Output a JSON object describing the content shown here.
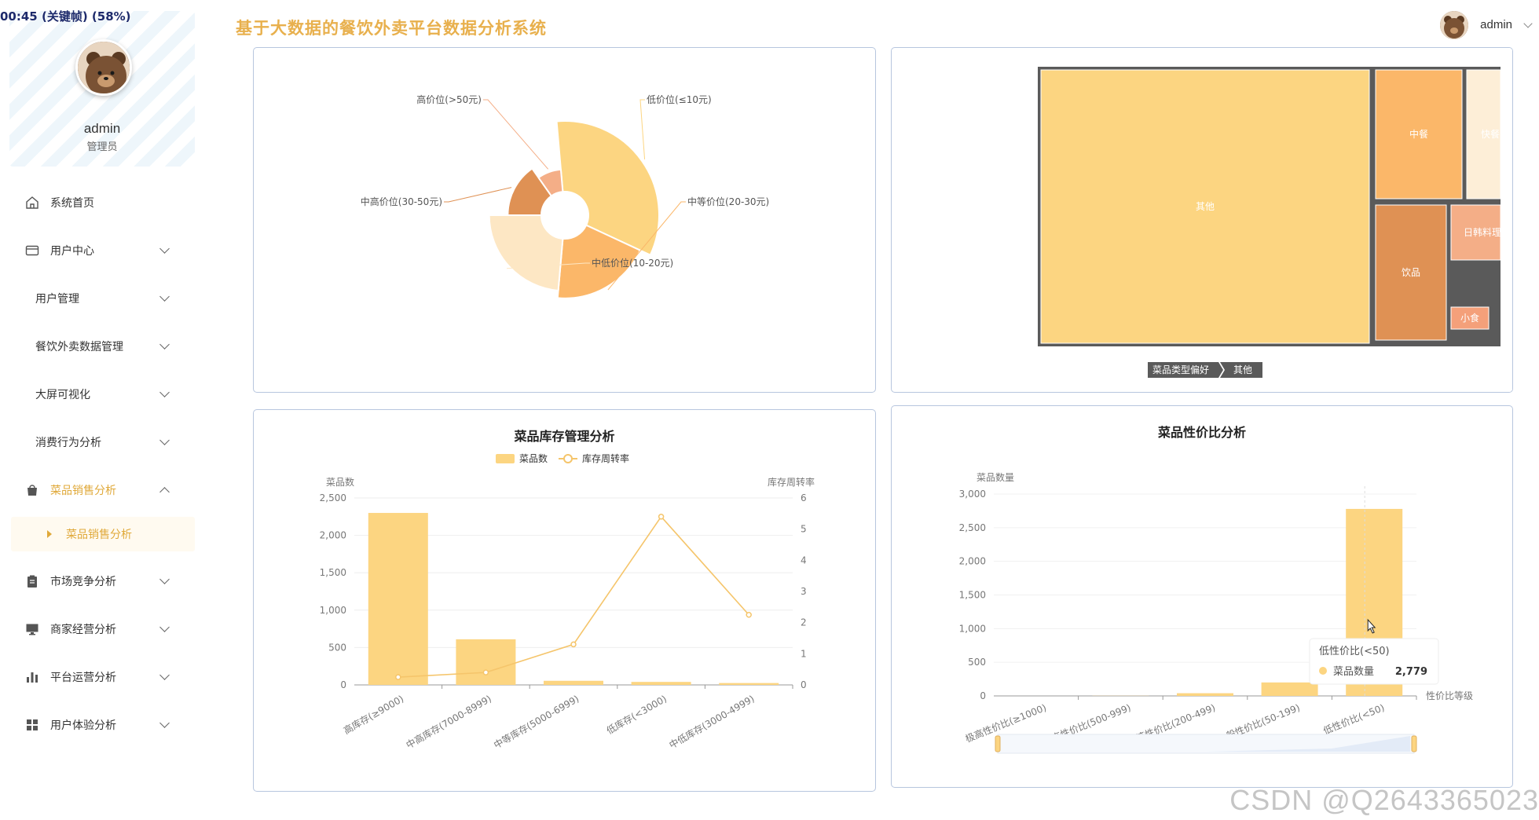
{
  "timer": "00:45 (关键帧) (58%)",
  "header": {
    "title": "基于大数据的餐饮外卖平台数据分析系统",
    "user": "admin"
  },
  "profile": {
    "name": "admin",
    "role": "管理员"
  },
  "sidebar": {
    "items": [
      {
        "label": "系统首页",
        "icon": "home-icon",
        "expandable": false
      },
      {
        "label": "用户中心",
        "icon": "credit-card-icon",
        "expandable": true
      },
      {
        "label": "用户管理",
        "icon": "",
        "expandable": true
      },
      {
        "label": "餐饮外卖数据管理",
        "icon": "",
        "expandable": true
      },
      {
        "label": "大屏可视化",
        "icon": "",
        "expandable": true
      },
      {
        "label": "消费行为分析",
        "icon": "",
        "expandable": true
      },
      {
        "label": "菜品销售分析",
        "icon": "shopping-bag-icon",
        "expandable": true,
        "active": true
      },
      {
        "label": "市场竞争分析",
        "icon": "clipboard-icon",
        "expandable": true
      },
      {
        "label": "商家经营分析",
        "icon": "monitor-icon",
        "expandable": true
      },
      {
        "label": "平台运营分析",
        "icon": "bar-chart-icon",
        "expandable": true
      },
      {
        "label": "用户体验分析",
        "icon": "grid-icon",
        "expandable": true
      }
    ],
    "active_sub": "菜品销售分析"
  },
  "colors": {
    "accent": "#e8b04d",
    "bar": "#fcd581",
    "line": "#f5c56b",
    "panel_border": "#b7c6de",
    "treemap_border": "#5a5a5a"
  },
  "chart_data": [
    {
      "type": "pie",
      "variant": "rose",
      "title": "",
      "slices": [
        {
          "label": "低价位(≤10元)",
          "value": 95,
          "color": "#fcd581"
        },
        {
          "label": "中等价位(20-30元)",
          "value": 80,
          "color": "#fbb769"
        },
        {
          "label": "中低价位(10-20元)",
          "value": 70,
          "color": "#fde7c4"
        },
        {
          "label": "中高价位(30-50元)",
          "value": 45,
          "color": "#df9154"
        },
        {
          "label": "高价位(>50元)",
          "value": 30,
          "color": "#f4ae87"
        }
      ]
    },
    {
      "type": "treemap",
      "title": "",
      "nodes": [
        {
          "label": "其他",
          "color": "#fcd581"
        },
        {
          "label": "中餐",
          "color": "#fbb769"
        },
        {
          "label": "快餐",
          "color": "#fdeed7"
        },
        {
          "label": "饮品",
          "color": "#df9154"
        },
        {
          "label": "日韩料理",
          "color": "#f4ae87"
        },
        {
          "label": "小食",
          "color": "#f4a07a"
        }
      ],
      "breadcrumb": [
        "菜品类型偏好",
        "其他"
      ]
    },
    {
      "type": "bar",
      "title": "菜品库存管理分析",
      "legend": [
        "菜品数",
        "库存周转率"
      ],
      "ylabel_left": "菜品数",
      "ylabel_right": "库存周转率",
      "categories": [
        "高库存(≥9000)",
        "中高库存(7000-8999)",
        "中等库存(5000-6999)",
        "低库存(<3000)",
        "中低库存(3000-4999)"
      ],
      "series": [
        {
          "name": "菜品数",
          "type": "bar",
          "values": [
            2300,
            610,
            55,
            40,
            25
          ]
        },
        {
          "name": "库存周转率",
          "type": "line",
          "values": [
            0.25,
            0.4,
            1.3,
            5.4,
            2.25
          ]
        }
      ],
      "ylim_left": [
        0,
        2500
      ],
      "yticks_left": [
        "0",
        "500",
        "1,000",
        "1,500",
        "2,000",
        "2,500"
      ],
      "ylim_right": [
        0,
        6
      ],
      "yticks_right": [
        "0",
        "1",
        "2",
        "3",
        "4",
        "5",
        "6"
      ]
    },
    {
      "type": "bar",
      "title": "菜品性价比分析",
      "ylabel": "菜品数量",
      "xlabel": "性价比等级",
      "categories": [
        "极高性价比(≥1000)",
        "高性价比(500-999)",
        "中等性价比(200-499)",
        "一般性价比(50-199)",
        "低性价比(<50)"
      ],
      "series": [
        {
          "name": "菜品数量",
          "values": [
            0,
            2,
            40,
            200,
            2779
          ]
        }
      ],
      "ylim": [
        0,
        3000
      ],
      "yticks": [
        "0",
        "500",
        "1,000",
        "1,500",
        "2,000",
        "2,500",
        "3,000"
      ],
      "tooltip": {
        "title": "低性价比(<50)",
        "series": "菜品数量",
        "value": "2,779"
      }
    }
  ],
  "watermark": "CSDN @Q2643365023"
}
